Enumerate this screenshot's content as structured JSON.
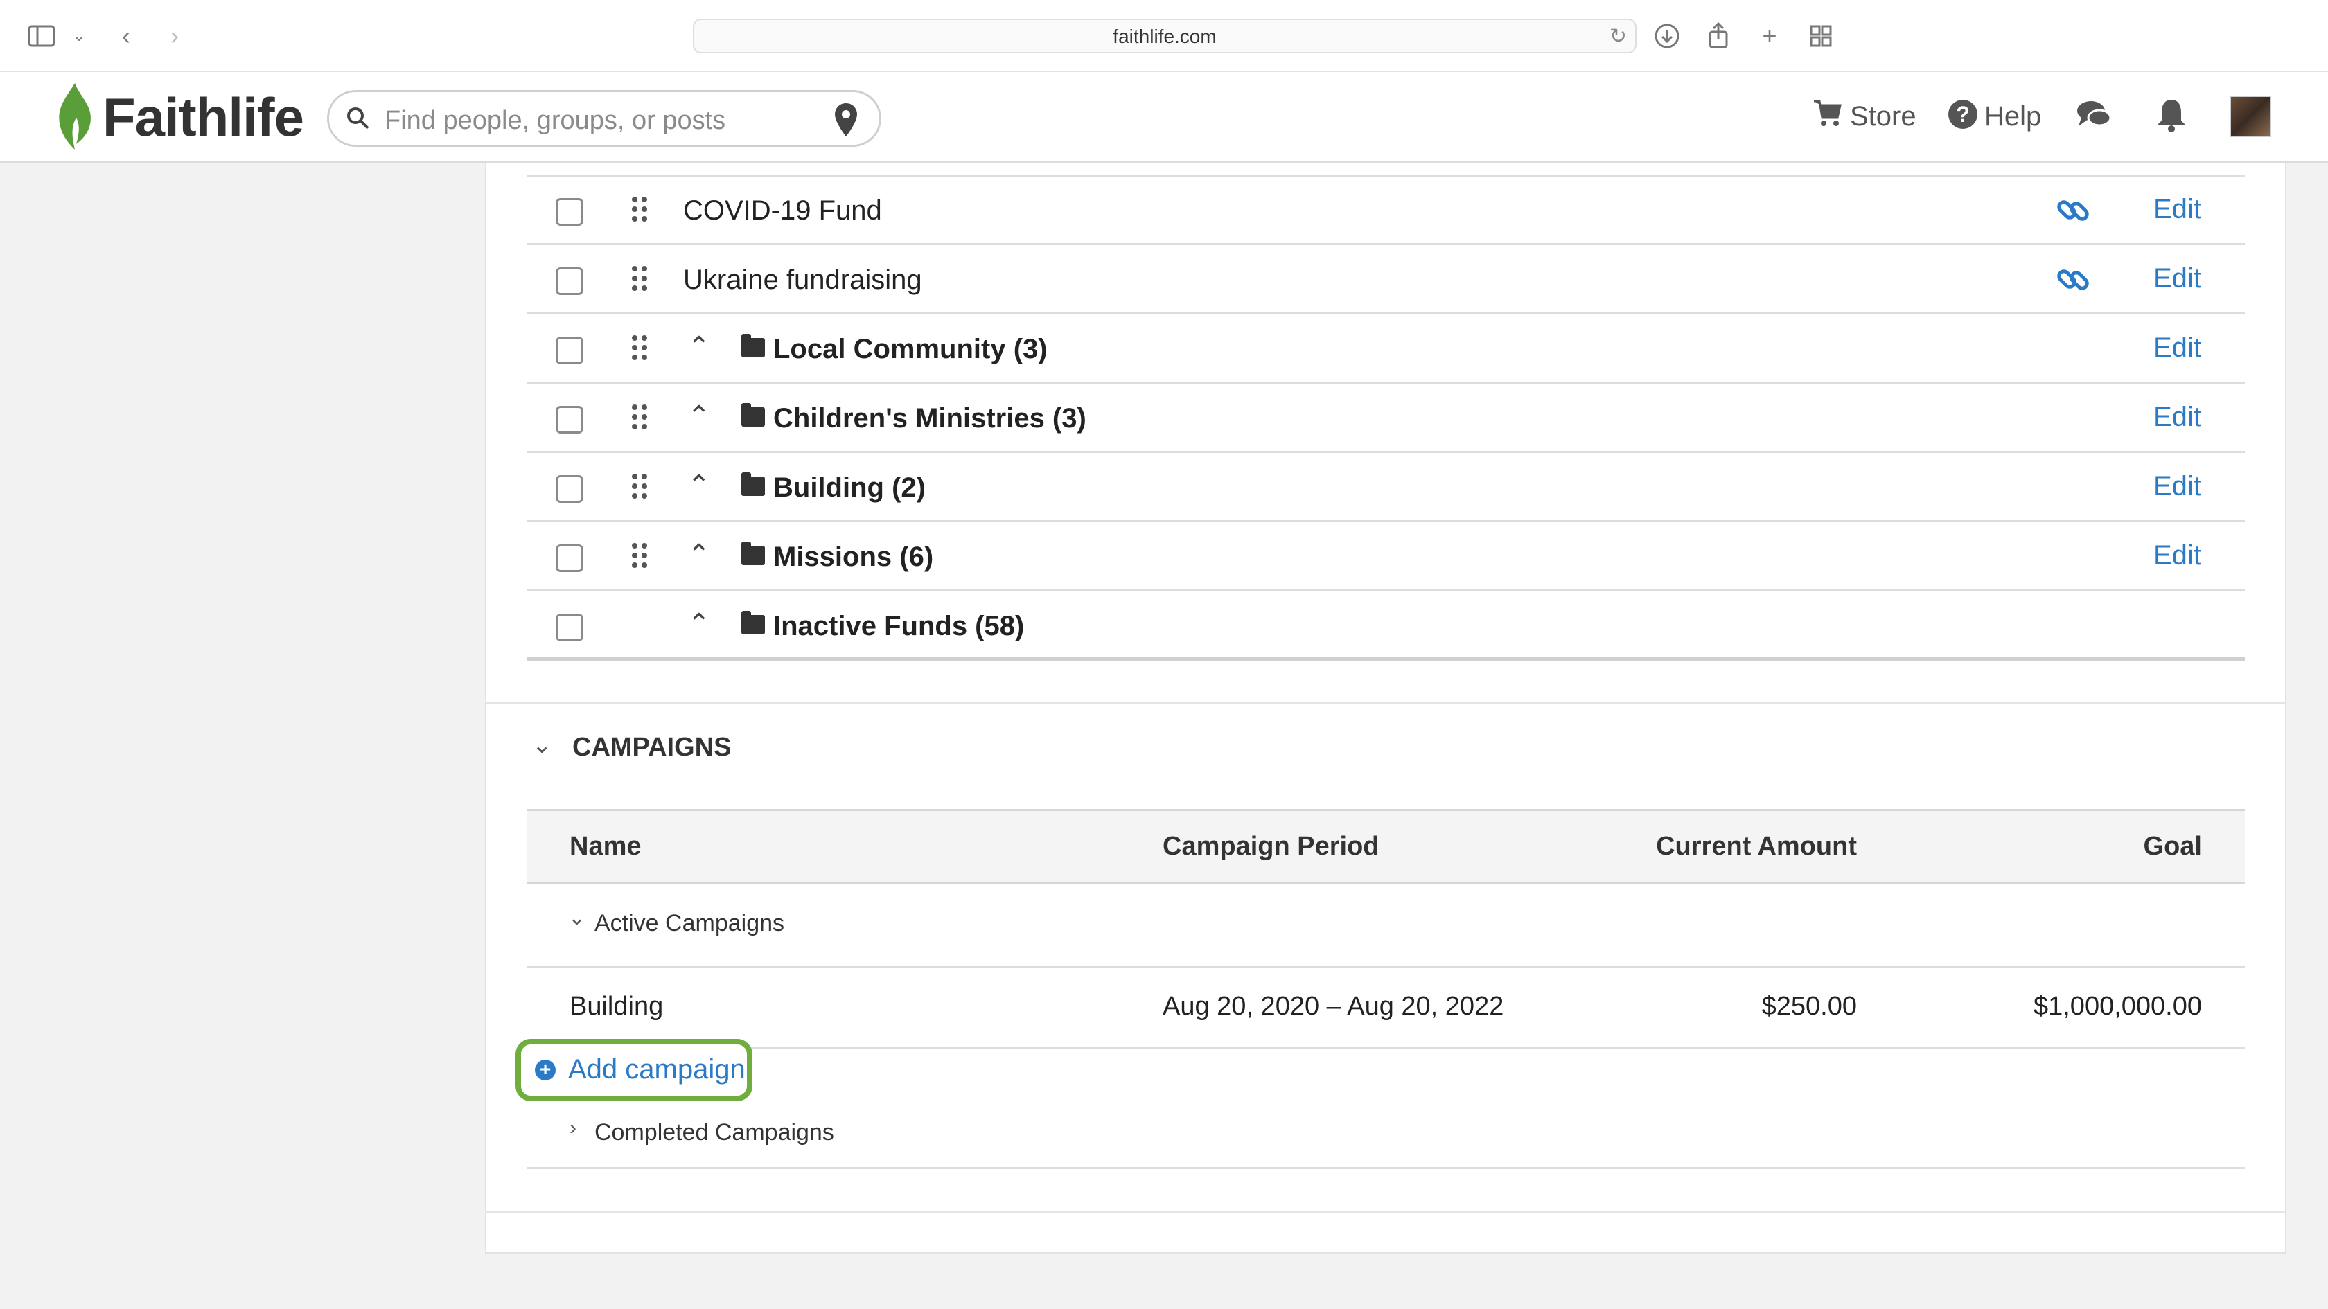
{
  "browser": {
    "url": "faithlife.com"
  },
  "header": {
    "logo": "Faithlife",
    "search_placeholder": "Find people, groups, or posts",
    "store_label": "Store",
    "help_label": "Help"
  },
  "funds": {
    "rows": [
      {
        "name": "COVID-19 Fund",
        "folder": false,
        "link": true,
        "edit": "Edit"
      },
      {
        "name": "Ukraine fundraising",
        "folder": false,
        "link": true,
        "edit": "Edit"
      },
      {
        "name": "Local Community (3)",
        "folder": true,
        "link": false,
        "edit": "Edit"
      },
      {
        "name": "Children's Ministries (3)",
        "folder": true,
        "link": false,
        "edit": "Edit"
      },
      {
        "name": "Building (2)",
        "folder": true,
        "link": false,
        "edit": "Edit"
      },
      {
        "name": "Missions (6)",
        "folder": true,
        "link": false,
        "edit": "Edit"
      },
      {
        "name": "Inactive Funds (58)",
        "folder": true,
        "link": false,
        "edit": ""
      }
    ]
  },
  "campaigns": {
    "section_title": "CAMPAIGNS",
    "columns": {
      "name": "Name",
      "period": "Campaign Period",
      "current": "Current Amount",
      "goal": "Goal"
    },
    "active_group": "Active Campaigns",
    "rows": [
      {
        "name": "Building",
        "period": "Aug 20, 2020 – Aug 20, 2022",
        "current": "$250.00",
        "goal": "$1,000,000.00"
      }
    ],
    "add_label": "Add campaign",
    "completed_group": "Completed Campaigns"
  },
  "colors": {
    "link": "#2a7ac7",
    "highlight": "#6fae3e",
    "brand_green": "#5a9e3a"
  }
}
